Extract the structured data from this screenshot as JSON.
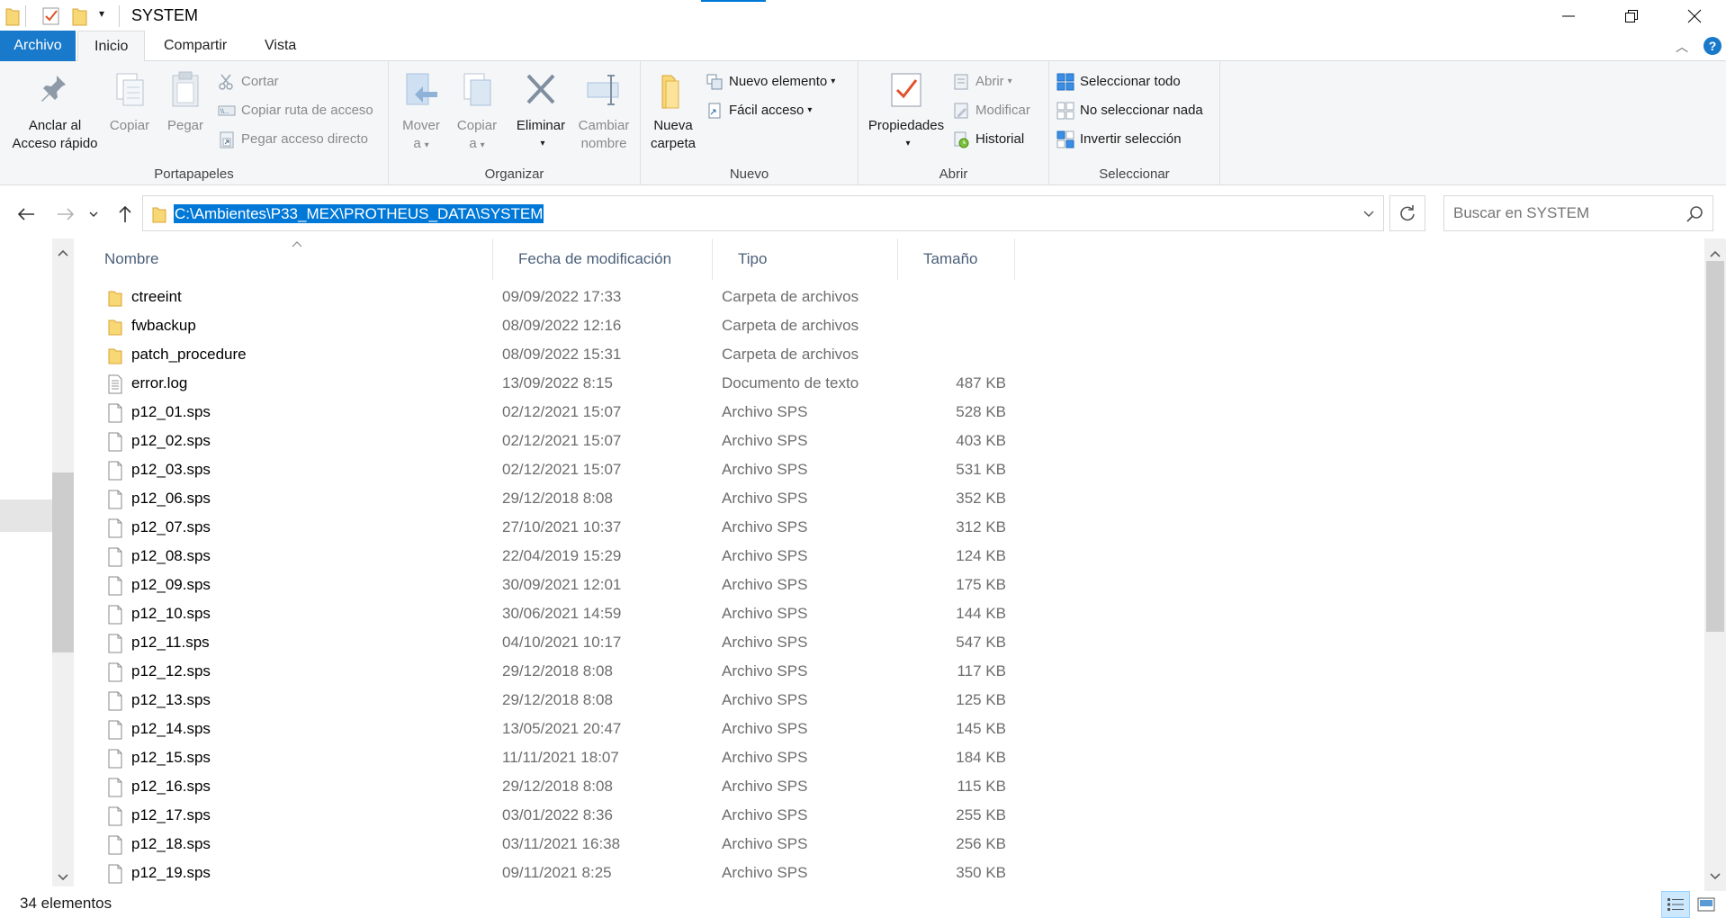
{
  "window": {
    "title": "SYSTEM",
    "minimize": "—",
    "restore": "❐",
    "close": "✕"
  },
  "ribbon_tabs": [
    {
      "label": "Archivo"
    },
    {
      "label": "Inicio"
    },
    {
      "label": "Compartir"
    },
    {
      "label": "Vista"
    }
  ],
  "ribbon": {
    "portapapeles": {
      "label": "Portapapeles",
      "pin_line1": "Anclar al",
      "pin_line2": "Acceso rápido",
      "copy": "Copiar",
      "paste": "Pegar",
      "cut": "Cortar",
      "copy_path": "Copiar ruta de acceso",
      "paste_shortcut": "Pegar acceso directo"
    },
    "organizar": {
      "label": "Organizar",
      "move_line1": "Mover",
      "move_line2": "a",
      "copy_line1": "Copiar",
      "copy_line2": "a",
      "delete": "Eliminar",
      "rename_line1": "Cambiar",
      "rename_line2": "nombre"
    },
    "nuevo": {
      "label": "Nuevo",
      "new_folder_line1": "Nueva",
      "new_folder_line2": "carpeta",
      "new_item": "Nuevo elemento",
      "easy_access": "Fácil acceso"
    },
    "abrir": {
      "label": "Abrir",
      "properties": "Propiedades",
      "open": "Abrir",
      "edit": "Modificar",
      "history": "Historial"
    },
    "seleccionar": {
      "label": "Seleccionar",
      "select_all": "Seleccionar todo",
      "select_none": "No seleccionar nada",
      "invert": "Invertir selección"
    }
  },
  "address": {
    "path": "C:\\Ambientes\\P33_MEX\\PROTHEUS_DATA\\SYSTEM"
  },
  "search": {
    "placeholder": "Buscar en SYSTEM"
  },
  "columns": {
    "name": "Nombre",
    "date": "Fecha de modificación",
    "type": "Tipo",
    "size": "Tamaño"
  },
  "files": [
    {
      "name": "ctreeint",
      "date": "09/09/2022 17:33",
      "type": "Carpeta de archivos",
      "size": "",
      "kind": "folder"
    },
    {
      "name": "fwbackup",
      "date": "08/09/2022 12:16",
      "type": "Carpeta de archivos",
      "size": "",
      "kind": "folder"
    },
    {
      "name": "patch_procedure",
      "date": "08/09/2022 15:31",
      "type": "Carpeta de archivos",
      "size": "",
      "kind": "folder"
    },
    {
      "name": "error.log",
      "date": "13/09/2022 8:15",
      "type": "Documento de texto",
      "size": "487 KB",
      "kind": "text"
    },
    {
      "name": "p12_01.sps",
      "date": "02/12/2021 15:07",
      "type": "Archivo SPS",
      "size": "528 KB",
      "kind": "file"
    },
    {
      "name": "p12_02.sps",
      "date": "02/12/2021 15:07",
      "type": "Archivo SPS",
      "size": "403 KB",
      "kind": "file"
    },
    {
      "name": "p12_03.sps",
      "date": "02/12/2021 15:07",
      "type": "Archivo SPS",
      "size": "531 KB",
      "kind": "file"
    },
    {
      "name": "p12_06.sps",
      "date": "29/12/2018 8:08",
      "type": "Archivo SPS",
      "size": "352 KB",
      "kind": "file"
    },
    {
      "name": "p12_07.sps",
      "date": "27/10/2021 10:37",
      "type": "Archivo SPS",
      "size": "312 KB",
      "kind": "file"
    },
    {
      "name": "p12_08.sps",
      "date": "22/04/2019 15:29",
      "type": "Archivo SPS",
      "size": "124 KB",
      "kind": "file"
    },
    {
      "name": "p12_09.sps",
      "date": "30/09/2021 12:01",
      "type": "Archivo SPS",
      "size": "175 KB",
      "kind": "file"
    },
    {
      "name": "p12_10.sps",
      "date": "30/06/2021 14:59",
      "type": "Archivo SPS",
      "size": "144 KB",
      "kind": "file"
    },
    {
      "name": "p12_11.sps",
      "date": "04/10/2021 10:17",
      "type": "Archivo SPS",
      "size": "547 KB",
      "kind": "file"
    },
    {
      "name": "p12_12.sps",
      "date": "29/12/2018 8:08",
      "type": "Archivo SPS",
      "size": "117 KB",
      "kind": "file"
    },
    {
      "name": "p12_13.sps",
      "date": "29/12/2018 8:08",
      "type": "Archivo SPS",
      "size": "125 KB",
      "kind": "file"
    },
    {
      "name": "p12_14.sps",
      "date": "13/05/2021 20:47",
      "type": "Archivo SPS",
      "size": "145 KB",
      "kind": "file"
    },
    {
      "name": "p12_15.sps",
      "date": "11/11/2021 18:07",
      "type": "Archivo SPS",
      "size": "184 KB",
      "kind": "file"
    },
    {
      "name": "p12_16.sps",
      "date": "29/12/2018 8:08",
      "type": "Archivo SPS",
      "size": "115 KB",
      "kind": "file"
    },
    {
      "name": "p12_17.sps",
      "date": "03/01/2022 8:36",
      "type": "Archivo SPS",
      "size": "255 KB",
      "kind": "file"
    },
    {
      "name": "p12_18.sps",
      "date": "03/11/2021 16:38",
      "type": "Archivo SPS",
      "size": "256 KB",
      "kind": "file"
    },
    {
      "name": "p12_19.sps",
      "date": "09/11/2021 8:25",
      "type": "Archivo SPS",
      "size": "350 KB",
      "kind": "file"
    }
  ],
  "status": {
    "count": "34 elementos"
  },
  "colors": {
    "accent": "#0078d7",
    "file_tab": "#1979ca",
    "folder": "#f8d775"
  }
}
